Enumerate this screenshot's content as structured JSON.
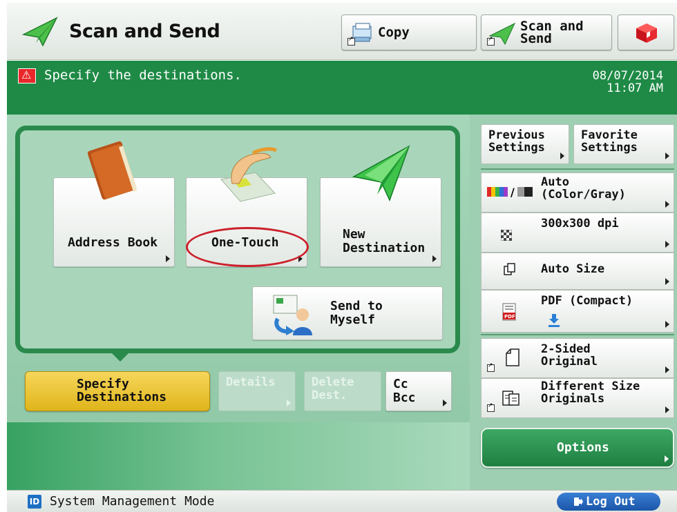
{
  "header": {
    "title": "Scan and Send",
    "copy_label": "Copy",
    "scan_send_label_line1": "Scan and",
    "scan_send_label_line2": "Send"
  },
  "status": {
    "message": "Specify the destinations.",
    "date": "08/07/2014",
    "time": "11:07 AM"
  },
  "destinations": {
    "address_book": "Address Book",
    "one_touch": "One-Touch",
    "new_destination_line1": "New",
    "new_destination_line2": "Destination",
    "send_to_myself_line1": "Send to",
    "send_to_myself_line2": "Myself"
  },
  "actions": {
    "specify_line1": "Specify",
    "specify_line2": "Destinations",
    "details": "Details",
    "delete_line1": "Delete",
    "delete_line2": "Dest.",
    "cc": "Cc",
    "bcc": "Bcc"
  },
  "settings": {
    "previous_line1": "Previous",
    "previous_line2": "Settings",
    "favorite_line1": "Favorite",
    "favorite_line2": "Settings",
    "color_line1": "Auto",
    "color_line2": "(Color/Gray)",
    "resolution": "300x300 dpi",
    "size": "Auto Size",
    "format": "PDF (Compact)",
    "sided_line1": "2-Sided",
    "sided_line2": "Original",
    "diffsize_line1": "Different Size",
    "diffsize_line2": "Originals",
    "options": "Options"
  },
  "footer": {
    "id_label": "ID",
    "mode": "System Management Mode",
    "logout": "Log Out"
  },
  "icons": {
    "app": "scan-send-icon",
    "copy": "copy-icon",
    "warning": "warning-icon",
    "address_book": "address-book-icon",
    "one_touch": "one-touch-icon",
    "new_destination": "new-destination-icon",
    "send_to_myself": "send-to-myself-icon",
    "color_mode": "color-mode-icon",
    "resolution": "resolution-icon",
    "scan_size": "scan-size-icon",
    "file_format": "pdf-file-icon",
    "two_sided": "two-sided-icon",
    "different_size": "different-size-icon",
    "logout": "logout-icon"
  },
  "colors": {
    "status_green": "#1e8a46",
    "panel_green": "#2a8a4c",
    "specify_yellow": "#e0b51b",
    "options_green": "#1f7f42",
    "logout_blue": "#1a56a8",
    "annotation_red": "#cc1f2a"
  }
}
